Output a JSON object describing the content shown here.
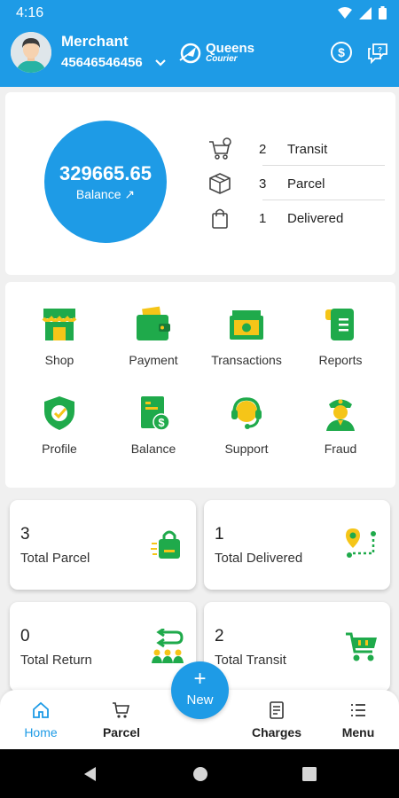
{
  "status": {
    "time": "4:16"
  },
  "header": {
    "merchant_label": "Merchant",
    "merchant_phone": "45646546456",
    "brand_name": "Queens",
    "brand_sub": "Courier"
  },
  "summary": {
    "balance_value": "329665.65",
    "balance_label": "Balance ↗",
    "stats": [
      {
        "count": "2",
        "label": "Transit",
        "icon": "cart-icon"
      },
      {
        "count": "3",
        "label": "Parcel",
        "icon": "box-icon"
      },
      {
        "count": "1",
        "label": "Delivered",
        "icon": "bag-icon"
      }
    ]
  },
  "menu": [
    {
      "label": "Shop",
      "icon": "shop-icon"
    },
    {
      "label": "Payment",
      "icon": "wallet-icon"
    },
    {
      "label": "Transactions",
      "icon": "cash-icon"
    },
    {
      "label": "Reports",
      "icon": "report-icon"
    },
    {
      "label": "Profile",
      "icon": "shield-check-icon"
    },
    {
      "label": "Balance",
      "icon": "balance-doc-icon"
    },
    {
      "label": "Support",
      "icon": "headset-icon"
    },
    {
      "label": "Fraud",
      "icon": "officer-icon"
    }
  ],
  "tiles": [
    {
      "count": "3",
      "label": "Total Parcel",
      "icon": "shopping-bag-icon"
    },
    {
      "count": "1",
      "label": "Total Delivered",
      "icon": "route-pin-icon"
    },
    {
      "count": "0",
      "label": "Total Return",
      "icon": "return-people-icon"
    },
    {
      "count": "2",
      "label": "Total Transit",
      "icon": "cart-icon"
    }
  ],
  "bottom_nav": {
    "home": "Home",
    "parcel": "Parcel",
    "new_plus": "+",
    "new_label": "New",
    "charges": "Charges",
    "menu": "Menu"
  },
  "colors": {
    "primary": "#1e9be6",
    "green": "#1faa4b",
    "yellow": "#f5c518"
  }
}
